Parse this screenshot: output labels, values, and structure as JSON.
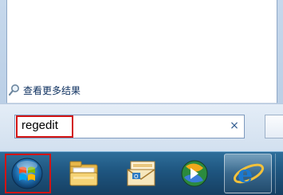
{
  "start_menu": {
    "more_results_label": "查看更多结果"
  },
  "search": {
    "value": "regedit",
    "clear_glyph": "×"
  },
  "taskbar": {
    "items": [
      {
        "icon": "windows-start-orb-icon"
      },
      {
        "icon": "windows-explorer-folder-icon"
      },
      {
        "icon": "outlook-mail-icon"
      },
      {
        "icon": "media-player-icon"
      },
      {
        "icon": "internet-explorer-icon"
      }
    ]
  },
  "colors": {
    "highlight_box": "#d21414",
    "taskbar": "#1e557f"
  }
}
